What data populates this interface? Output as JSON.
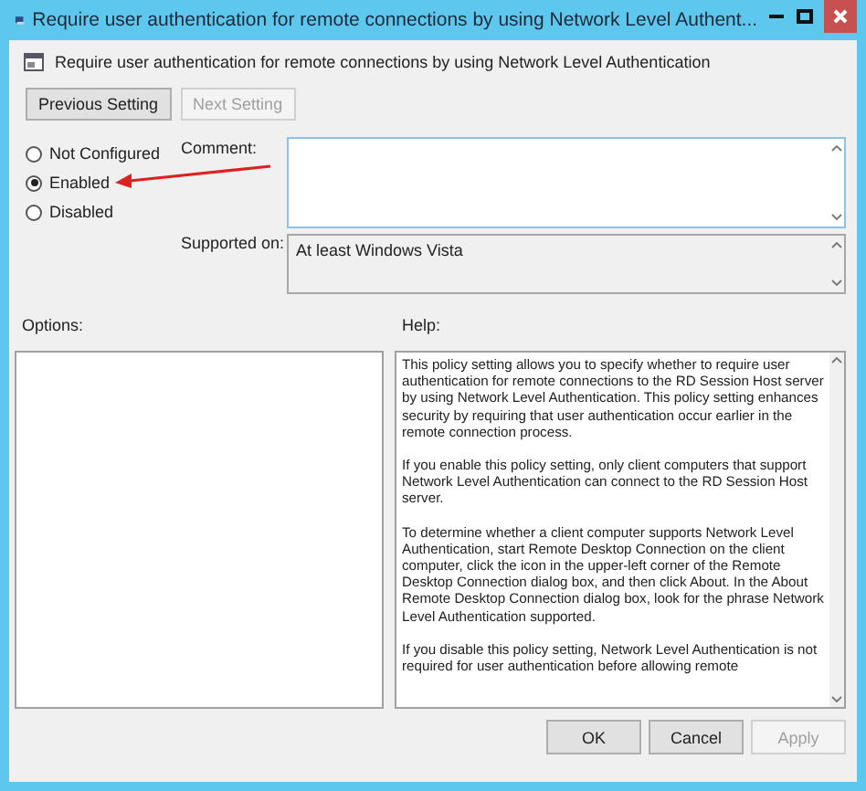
{
  "window": {
    "title": "Require user authentication for remote connections by using Network Level Authent..."
  },
  "setting_title": "Require user authentication for remote connections by using Network Level Authentication",
  "nav_buttons": [
    {
      "label": "Previous Setting",
      "disabled": false
    },
    {
      "label": "Next Setting",
      "disabled": true
    }
  ],
  "states": [
    {
      "label": "Not Configured",
      "selected": false
    },
    {
      "label": "Enabled",
      "selected": true
    },
    {
      "label": "Disabled",
      "selected": false
    }
  ],
  "comment": {
    "label": "Comment:"
  },
  "supported_on": {
    "label": "Supported on:",
    "value": "At least Windows Vista"
  },
  "options": {
    "label": "Options:"
  },
  "help": {
    "label": "Help:",
    "paragraphs": [
      "This policy setting allows you to specify whether to require user authentication for remote connections to the RD Session Host server by using Network Level Authentication. This policy setting enhances security by requiring that user authentication occur earlier in the remote connection process.",
      "If you enable this policy setting, only client computers that support Network Level Authentication can connect to the RD Session Host server.",
      "To determine whether a client computer supports Network Level Authentication, start Remote Desktop Connection on the client computer, click the icon in the upper-left corner of the Remote Desktop Connection dialog box, and then click About. In the About Remote Desktop Connection dialog box, look for the phrase Network Level Authentication supported.",
      "If you disable this policy setting, Network Level Authentication is not required for user authentication before allowing remote"
    ]
  },
  "buttons": [
    {
      "label": "OK",
      "disabled": false
    },
    {
      "label": "Cancel",
      "disabled": false
    },
    {
      "label": "Apply",
      "disabled": true
    }
  ]
}
